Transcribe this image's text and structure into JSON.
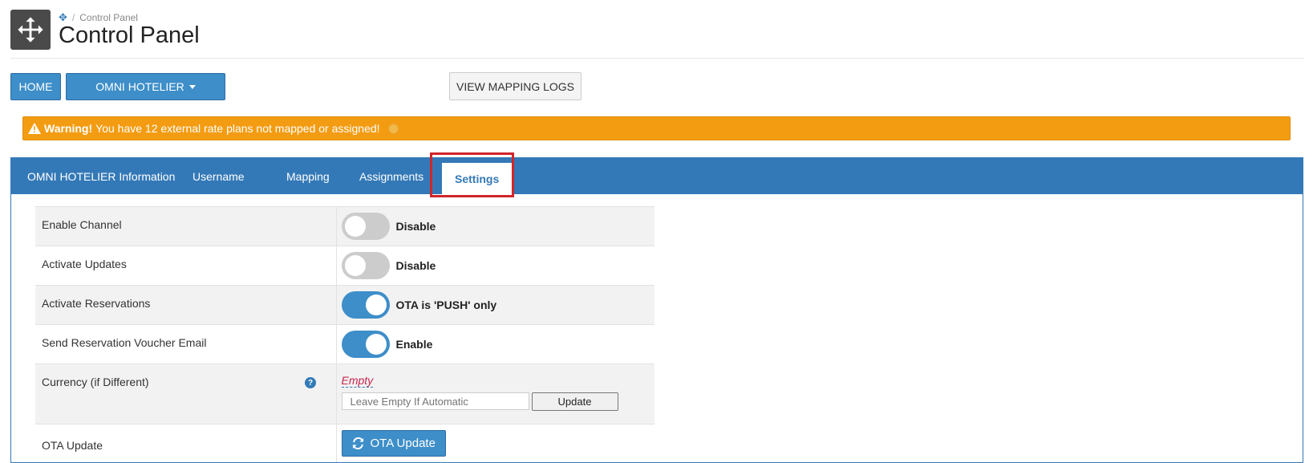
{
  "header": {
    "breadcrumb_current": "Control Panel",
    "title": "Control Panel",
    "icon": "move-arrows-icon"
  },
  "toolbar": {
    "home_label": "HOME",
    "omni_label": "OMNI HOTELIER",
    "logs_label": "VIEW MAPPING LOGS"
  },
  "warning": {
    "strong": "Warning!",
    "text": "You have 12 external rate plans not mapped or assigned!",
    "color": "#f39c12"
  },
  "tabs": [
    {
      "label": "OMNI HOTELIER Information"
    },
    {
      "label": "Username"
    },
    {
      "label": "Mapping"
    },
    {
      "label": "Assignments"
    },
    {
      "label": "Settings",
      "active": true
    }
  ],
  "settings": {
    "rows": [
      {
        "label": "Enable Channel",
        "state": "off",
        "text": "Disable"
      },
      {
        "label": "Activate Updates",
        "state": "off",
        "text": "Disable"
      },
      {
        "label": "Activate Reservations",
        "state": "on",
        "text": "OTA is 'PUSH' only"
      },
      {
        "label": "Send Reservation Voucher Email",
        "state": "on",
        "text": "Enable"
      }
    ],
    "currency": {
      "label": "Currency (if Different)",
      "empty_text": "Empty",
      "placeholder": "Leave Empty If Automatic",
      "update_label": "Update"
    },
    "ota": {
      "label": "OTA Update",
      "button_label": "OTA Update"
    }
  },
  "colors": {
    "accent": "#3479b7",
    "button": "#3d8ec9",
    "highlight": "#d0262b"
  }
}
